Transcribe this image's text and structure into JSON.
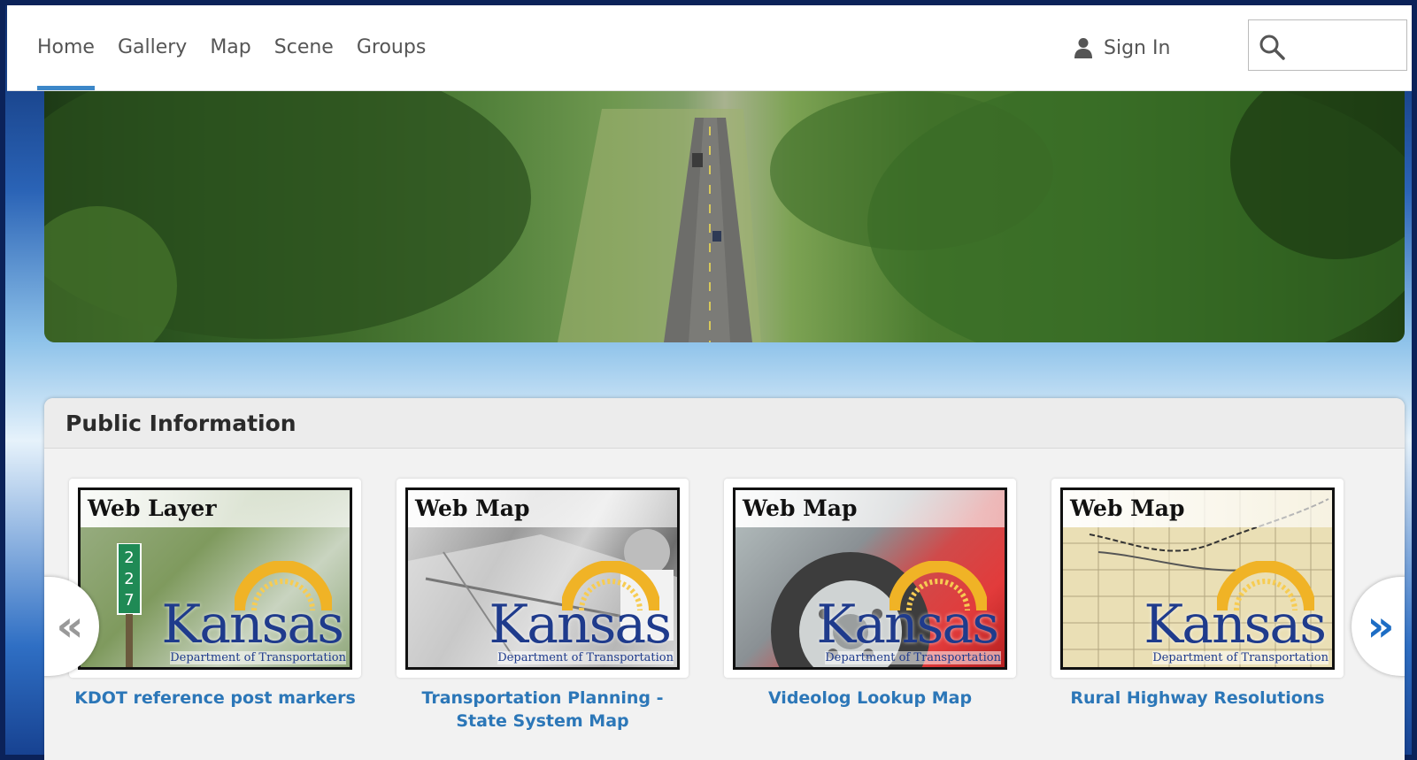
{
  "nav": {
    "items": [
      {
        "label": "Home",
        "active": true
      },
      {
        "label": "Gallery"
      },
      {
        "label": "Map"
      },
      {
        "label": "Scene"
      },
      {
        "label": "Groups"
      }
    ],
    "signin_label": "Sign In",
    "search_placeholder": ""
  },
  "panel": {
    "title": "Public Information",
    "prev_label": "«",
    "next_label": "»",
    "cards": [
      {
        "type": "Web Layer",
        "title": "KDOT reference post markers",
        "theme": "forest"
      },
      {
        "type": "Web Map",
        "title": "Transportation Planning - State System Map",
        "theme": "gray"
      },
      {
        "type": "Web Map",
        "title": "Videolog Lookup Map",
        "theme": "red"
      },
      {
        "type": "Web Map",
        "title": "Rural Highway Resolutions",
        "theme": "parchment"
      }
    ],
    "logo_text": "Kansas",
    "logo_sub": "Department of Transportation"
  },
  "colors": {
    "accent": "#3c87c8",
    "link": "#2c77b8",
    "logo_blue": "#1f3b8c",
    "logo_gold": "#f0b326"
  }
}
